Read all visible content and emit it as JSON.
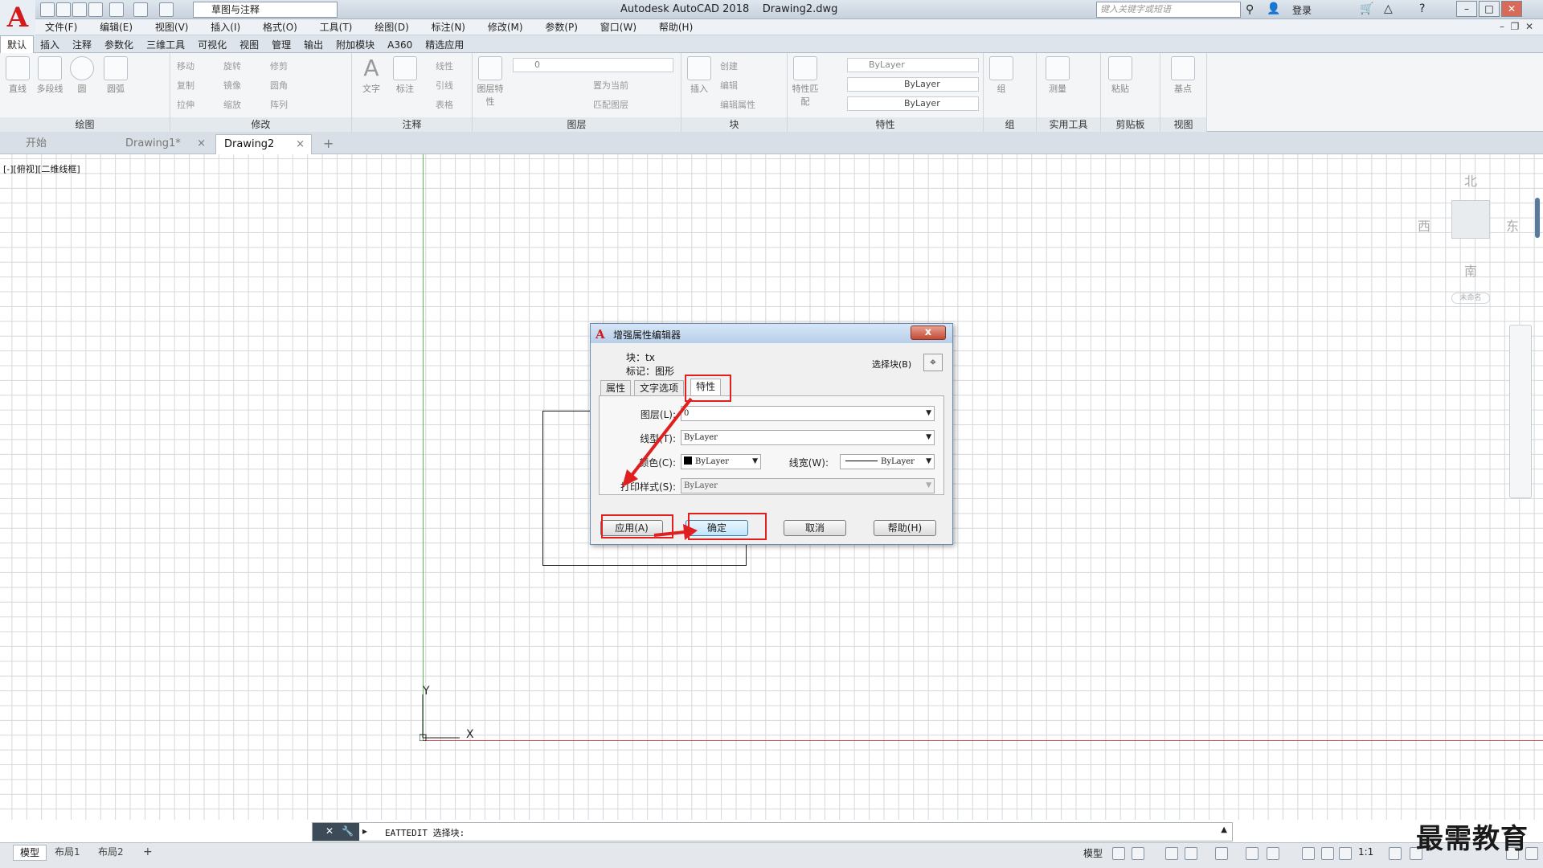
{
  "title_bar": {
    "app_title": "Autodesk AutoCAD 2018",
    "file_name": "Drawing2.dwg",
    "workspace": "草图与注释",
    "search_placeholder": "键入关键字或短语",
    "login": "登录"
  },
  "menu": [
    "文件(F)",
    "编辑(E)",
    "视图(V)",
    "插入(I)",
    "格式(O)",
    "工具(T)",
    "绘图(D)",
    "标注(N)",
    "修改(M)",
    "参数(P)",
    "窗口(W)",
    "帮助(H)"
  ],
  "ribbon_tabs": [
    "默认",
    "插入",
    "注释",
    "参数化",
    "三维工具",
    "可视化",
    "视图",
    "管理",
    "输出",
    "附加模块",
    "A360",
    "精选应用"
  ],
  "ribbon": {
    "draw": {
      "title": "绘图",
      "tools": [
        "直线",
        "多段线",
        "圆",
        "圆弧"
      ]
    },
    "modify": {
      "title": "修改",
      "tools": [
        "移动",
        "旋转",
        "修剪",
        "复制",
        "镜像",
        "圆角",
        "拉伸",
        "缩放",
        "阵列"
      ]
    },
    "annotation": {
      "title": "注释",
      "tools": [
        "文字",
        "标注",
        "线性",
        "引线",
        "表格"
      ]
    },
    "layers": {
      "title": "图层",
      "tools": [
        "图层特性",
        "置为当前",
        "匹配图层"
      ],
      "current_layer": "0"
    },
    "block": {
      "title": "块",
      "tools": [
        "插入",
        "创建",
        "编辑",
        "编辑属性"
      ]
    },
    "properties": {
      "title": "特性",
      "match": "特性匹配",
      "color": "ByLayer",
      "linetype": "ByLayer",
      "lineweight": "ByLayer"
    },
    "groups": {
      "title": "组",
      "tool": "组"
    },
    "utilities": {
      "title": "实用工具",
      "tool": "测量"
    },
    "clipboard": {
      "title": "剪贴板",
      "tool": "粘贴"
    },
    "view": {
      "title": "视图",
      "tool": "基点"
    }
  },
  "doc_tabs": [
    "开始",
    "Drawing1*",
    "Drawing2"
  ],
  "viewport_label": "[-][俯视][二维线框]",
  "compass": {
    "north": "北",
    "south": "南",
    "east": "东",
    "west": "西",
    "wcs": "未命名"
  },
  "ucs": {
    "x": "X",
    "y": "Y"
  },
  "dialog": {
    "title": "增强属性编辑器",
    "close": "x",
    "block_label": "块：tx",
    "tag_label": "标记：图形",
    "select_block": "选择块(B)",
    "tabs": [
      "属性",
      "文字选项",
      "特性"
    ],
    "fields": {
      "layer": {
        "label": "图层(L):",
        "value": "0"
      },
      "linetype": {
        "label": "线型(T):",
        "value": "ByLayer"
      },
      "color": {
        "label": "颜色(C):",
        "value": "ByLayer"
      },
      "lineweight": {
        "label": "线宽(W):",
        "value": "ByLayer"
      },
      "plotstyle": {
        "label": "打印样式(S):",
        "value": "ByLayer"
      }
    },
    "buttons": {
      "apply": "应用(A)",
      "ok": "确定",
      "cancel": "取消",
      "help": "帮助(H)"
    }
  },
  "command_line": "EATTEDIT 选择块:",
  "layout_tabs": [
    "模型",
    "布局1",
    "布局2"
  ],
  "status": {
    "space": "模型",
    "scale": "1:1"
  },
  "watermark": "最需教育",
  "colors": {
    "accent_red": "#e02020",
    "ucs_y": "#58b858",
    "ucs_x": "#d84a4a",
    "dialog_title": "#b8cfe8"
  }
}
